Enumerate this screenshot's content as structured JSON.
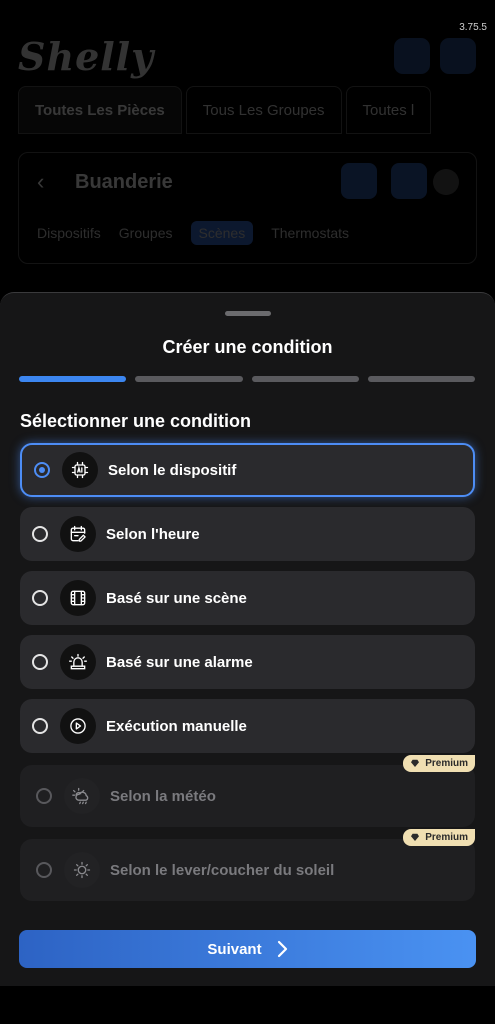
{
  "app": {
    "version": "3.75.5",
    "logo_text": "Shelly"
  },
  "top_tabs": [
    "Toutes Les Pièces",
    "Tous Les Groupes",
    "Toutes l"
  ],
  "room": {
    "title": "Buanderie",
    "tabs": [
      "Dispositifs",
      "Groupes",
      "Scènes",
      "Thermostats"
    ]
  },
  "sheet": {
    "title": "Créer une condition",
    "steps_completed": 1,
    "steps_total": 4,
    "section_title": "Sélectionner une condition",
    "options": [
      {
        "label": "Selon le dispositif",
        "icon": "chip-ai-icon",
        "selected": true,
        "enabled": true
      },
      {
        "label": "Selon l'heure",
        "icon": "calendar-edit-icon",
        "selected": false,
        "enabled": true
      },
      {
        "label": "Basé sur une scène",
        "icon": "film-icon",
        "selected": false,
        "enabled": true
      },
      {
        "label": "Basé sur une alarme",
        "icon": "siren-icon",
        "selected": false,
        "enabled": true
      },
      {
        "label": "Exécution manuelle",
        "icon": "play-circle-icon",
        "selected": false,
        "enabled": true
      },
      {
        "label": "Selon la météo",
        "icon": "weather-icon",
        "selected": false,
        "enabled": false,
        "badge": "Premium"
      },
      {
        "label": "Selon le lever/coucher du soleil",
        "icon": "sun-icon",
        "selected": false,
        "enabled": false,
        "badge": "Premium"
      }
    ],
    "next_label": "Suivant"
  },
  "colors": {
    "accent": "#3c86f0",
    "sheet_bg": "#161617",
    "option_bg": "#2a2a2d",
    "premium_badge": "#f0dfb2"
  }
}
